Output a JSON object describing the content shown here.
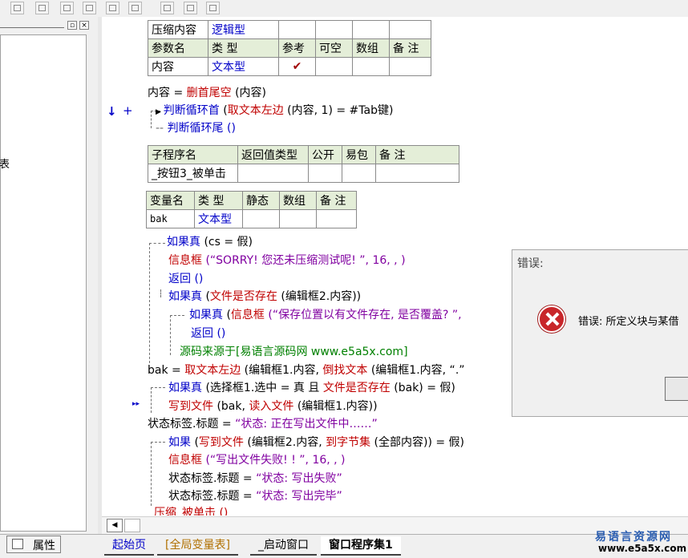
{
  "props_label": "属性",
  "tables": {
    "t1": {
      "row1": [
        "压缩内容",
        "逻辑型"
      ],
      "header": [
        "参数名",
        "类 型",
        "参考",
        "可空",
        "数组",
        "备 注"
      ],
      "row3": [
        "内容",
        "文本型",
        "✔"
      ]
    },
    "t2": {
      "header": [
        "子程序名",
        "返回值类型",
        "公开",
        "易包",
        "备 注"
      ],
      "row": [
        "_按钮3_被单击"
      ]
    },
    "t3": {
      "header": [
        "变量名",
        "类 型",
        "静态",
        "数组",
        "备 注"
      ],
      "row": [
        "bak",
        "文本型"
      ]
    }
  },
  "code": {
    "l1a": "内容 = ",
    "l1b": "删首尾空",
    "l1c": " (内容)",
    "l2a": "判断循环首",
    "l2b": " (",
    "l2c": "取文本左边",
    "l2d": " (内容, 1) = #Tab键)",
    "l3": "判断循环尾 ()",
    "gutter_arrow": "↓",
    "gutter_plus": "+",
    "gutter_mark": "▸▸",
    "c1a": "如果真",
    "c1b": " (cs = 假)",
    "c2a": "信息框",
    "c2b": " (“SORRY! 您还未压缩测试呢! ”, 16, , )",
    "c3": "返回 ()",
    "c4a": "如果真",
    "c4b": " (",
    "c4c": "文件是否存在",
    "c4d": " (编辑框2.内容))",
    "c5a": "如果真",
    "c5b": " (",
    "c5c": "信息框",
    "c5d": " (“保存位置以有文件存在, 是否覆盖? ”,",
    "c6": "返回 ()",
    "c7": "源码来源于[易语言源码网 www.e5a5x.com]",
    "c8a": "bak = ",
    "c8b": "取文本左边",
    "c8c": " (编辑框1.内容, ",
    "c8d": "倒找文本",
    "c8e": " (编辑框1.内容, “.”",
    "c9a": "如果真",
    "c9b": " (选择框1.选中 = 真 且 ",
    "c9c": "文件是否存在",
    "c9d": " (bak) = 假)",
    "c10a": "写到文件",
    "c10b": " (bak, ",
    "c10c": "读入文件",
    "c10d": " (编辑框1.内容))",
    "c11a": "状态标签.标题 = ",
    "c11b": "“状态: 正在写出文件中……”",
    "c12a": "如果",
    "c12b": " (",
    "c12c": "写到文件",
    "c12d": " (编辑框2.内容, ",
    "c12e": "到字节集",
    "c12f": " (全部内容)) = 假)",
    "c13a": "信息框",
    "c13b": " (“写出文件失败! ! ”, 16, , )",
    "c14a": "状态标签.标题 = ",
    "c14b": "“状态: 写出失败”",
    "c15a": "状态标签.标题 = ",
    "c15b": "“状态: 写出完毕”",
    "c16": "压缩_被单击 ()"
  },
  "dialog": {
    "title": "错误:",
    "message": "错误: 所定义块与某借"
  },
  "tabs": [
    "起始页",
    "[全局变量表]",
    "_启动窗口",
    "窗口程序集1"
  ],
  "watermark": {
    "line1": "易语言资源网",
    "line2": "www.e5a5x.com"
  },
  "colors": {
    "keyword": "#0000c8",
    "function": "#c00000",
    "string": "#8000a0",
    "comment": "#008000"
  }
}
